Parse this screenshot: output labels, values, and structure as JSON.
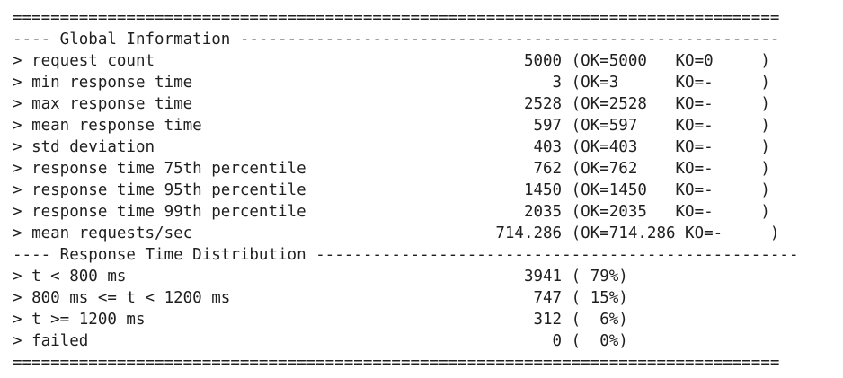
{
  "report": {
    "lines": [
      "=================================================================================",
      "---- Global Information ---------------------------------------------------------",
      "> request count                                       5000 (OK=5000   KO=0     )",
      "> min response time                                      3 (OK=3      KO=-     )",
      "> max response time                                   2528 (OK=2528   KO=-     )",
      "> mean response time                                   597 (OK=597    KO=-     )",
      "> std deviation                                        403 (OK=403    KO=-     )",
      "> response time 75th percentile                        762 (OK=762    KO=-     )",
      "> response time 95th percentile                       1450 (OK=1450   KO=-     )",
      "> response time 99th percentile                       2035 (OK=2035   KO=-     )",
      "> mean requests/sec                                714.286 (OK=714.286 KO=-     )",
      "---- Response Time Distribution ---------------------------------------------------",
      "> t < 800 ms                                          3941 ( 79%)",
      "> 800 ms <= t < 1200 ms                                747 ( 15%)",
      "> t >= 1200 ms                                         312 (  6%)",
      "> failed                                                 0 (  0%)",
      "================================================================================="
    ]
  }
}
